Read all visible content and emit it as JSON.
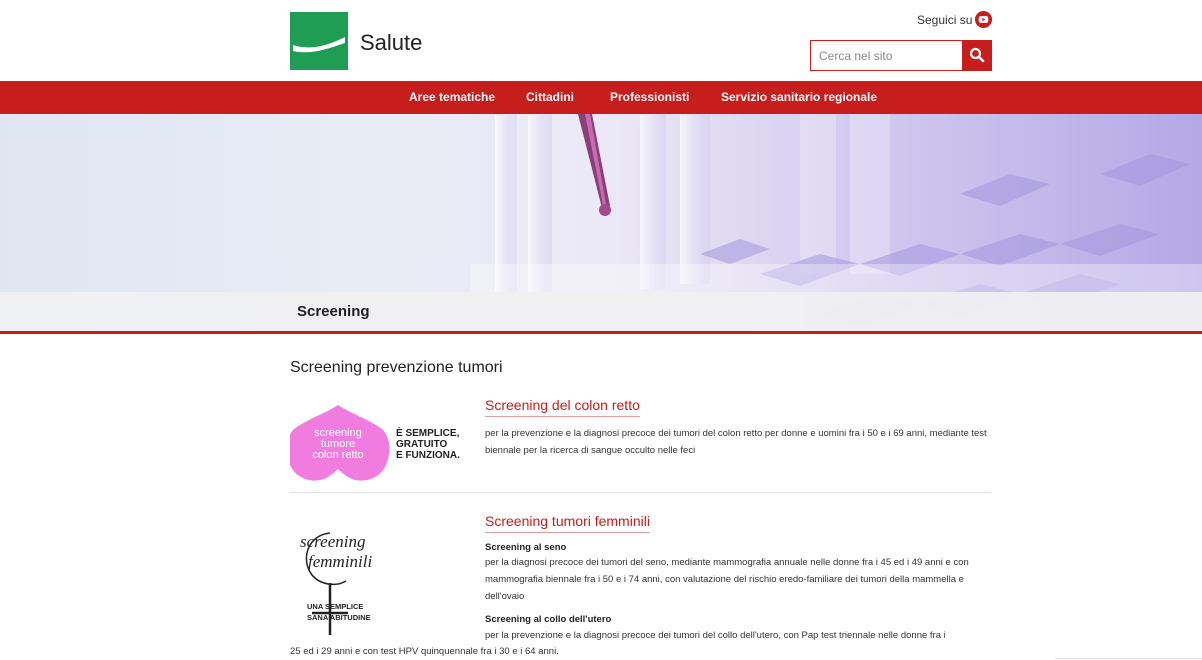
{
  "header": {
    "site_title": "Salute",
    "follow_label": "Seguici su",
    "search_placeholder": "Cerca nel sito"
  },
  "nav": {
    "items": [
      {
        "label": "Aree tematiche"
      },
      {
        "label": "Cittadini"
      },
      {
        "label": "Professionisti"
      },
      {
        "label": "Servizio sanitario regionale"
      }
    ]
  },
  "hero": {
    "title": "Screening"
  },
  "main": {
    "heading": "Screening prevenzione tumori",
    "items": [
      {
        "title": "Screening del colon retto",
        "text": "per la prevenzione e la diagnosi precoce dei tumori del colon retto per donne e uomini fra i 50 e i 69 anni, mediante test biennale per la ricerca di sangue occulto nelle feci",
        "logo_text": [
          "screening",
          "tumore",
          "colon retto"
        ],
        "slogan": [
          "È SEMPLICE,",
          "GRATUITO",
          "E FUNZIONA."
        ]
      },
      {
        "title": "Screening tumori femminili",
        "logo_text": [
          "screening",
          "femminili"
        ],
        "logo_tagline": [
          "UNA SEMPLICE",
          "SANA ABITUDINE"
        ],
        "sections": [
          {
            "heading": "Screening al seno",
            "text": "per la diagnosi precoce dei tumori del seno, mediante mammografia annuale nelle donne fra i 45 ed i 49 anni e con mammografia biennale fra i 50 e i 74 anni, con valutazione del rischio eredo-familiare dei tumori della mammella e dell'ovaio"
          },
          {
            "heading": "Screening al collo dell'utero",
            "text": "per la prevenzione e la diagnosi precoce dei tumori del collo dell'utero, con Pap test triennale nelle donne fra i",
            "text_cont": "25 ed i 29 anni e con test HPV quinquennale fra i 30 e i 64 anni."
          }
        ]
      }
    ]
  },
  "colors": {
    "brand_red": "#c61d1d",
    "logo_green": "#1f9d55",
    "colon_pink": "#f07ce0"
  }
}
